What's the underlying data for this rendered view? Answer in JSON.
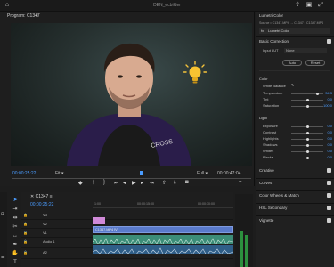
{
  "app": {
    "title": "DEN_ecbilder"
  },
  "monitor": {
    "tab_label": "Program: C1347",
    "timecode_left": "00:00:25:22",
    "fit_label": "Fit",
    "full_label": "Full",
    "timecode_right": "00:00:47:04"
  },
  "lumetri": {
    "title": "Lumetri Color",
    "source_line": "Source • C1347.MP4  →  C1347 • C1347.MP4",
    "effect_name": "Lumetri Color",
    "basic_correction": "Basic Correction",
    "input_lut_label": "Input LUT",
    "input_lut_value": "None",
    "auto_label": "Auto",
    "reset_label": "Reset",
    "color_header": "Color",
    "white_balance": "White Balance",
    "light_header": "Light",
    "color_sliders": [
      {
        "label": "Temperature",
        "value": "34,3",
        "pos": 0.82
      },
      {
        "label": "Tint",
        "value": "0,0",
        "pos": 0.5
      },
      {
        "label": "Saturation",
        "value": "100,0",
        "pos": 0.5
      }
    ],
    "light_sliders": [
      {
        "label": "Exposure",
        "value": "0,0",
        "pos": 0.5
      },
      {
        "label": "Contrast",
        "value": "0,0",
        "pos": 0.5
      },
      {
        "label": "Highlights",
        "value": "0,0",
        "pos": 0.5
      },
      {
        "label": "Shadows",
        "value": "0,0",
        "pos": 0.5
      },
      {
        "label": "Whites",
        "value": "0,0",
        "pos": 0.5
      },
      {
        "label": "Blacks",
        "value": "0,0",
        "pos": 0.5
      }
    ],
    "sections": [
      "Creative",
      "Curves",
      "Color Wheels & Match",
      "HSL Secondary",
      "Vignette"
    ]
  },
  "timeline": {
    "tab_label": "C1347",
    "timecode": "00:00:25:22",
    "ruler": [
      "1:00",
      "00:00:15:00",
      "00:00:30:00"
    ],
    "clip_label": "C1347.MP4 [V]",
    "tracks": [
      {
        "name": "V3"
      },
      {
        "name": "V2"
      },
      {
        "name": "V1"
      },
      {
        "name": "Audio 1"
      },
      {
        "name": "A2"
      }
    ]
  },
  "colors": {
    "accent": "#4a9cff",
    "clip_video": "#5a7acb",
    "clip_pink": "#d08ad8",
    "audio_green": "#3c8d78"
  }
}
